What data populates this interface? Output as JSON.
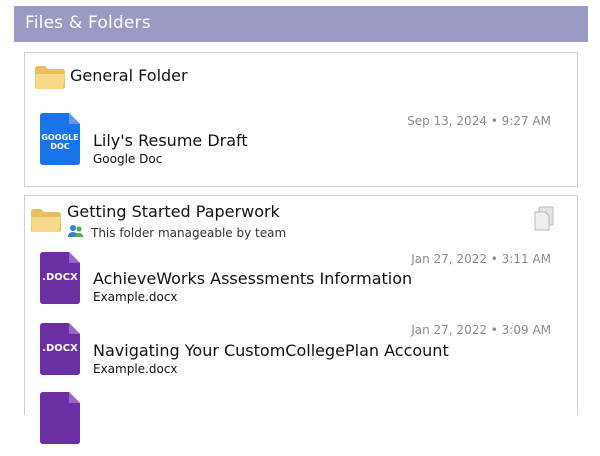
{
  "header": {
    "title": "Files & Folders"
  },
  "folders": [
    {
      "title": "General Folder",
      "files": [
        {
          "name": "Lily's Resume Draft",
          "type": "Google Doc",
          "timestamp": "Sep 13, 2024 • 9:27 AM",
          "icon_label": "GOOGLE DOC",
          "icon_color": "#1a73e8"
        }
      ]
    },
    {
      "title": "Getting Started Paperwork",
      "team_note": "This folder manageable by team",
      "files": [
        {
          "name": "AchieveWorks Assessments Information",
          "type": "Example.docx",
          "timestamp": "Jan 27, 2022 • 3:11 AM",
          "icon_label": ".DOCX",
          "icon_color": "#6b2fa3"
        },
        {
          "name": "Navigating Your CustomCollegePlan Account",
          "type": "Example.docx",
          "timestamp": "Jan 27, 2022 • 3:09 AM",
          "icon_label": ".DOCX",
          "icon_color": "#6b2fa3"
        }
      ]
    }
  ],
  "colors": {
    "header_bg": "#9a9ac4",
    "folder_yellow": "#f3d27a",
    "docx_purple": "#6b2fa3",
    "gdoc_blue": "#1a73e8"
  }
}
